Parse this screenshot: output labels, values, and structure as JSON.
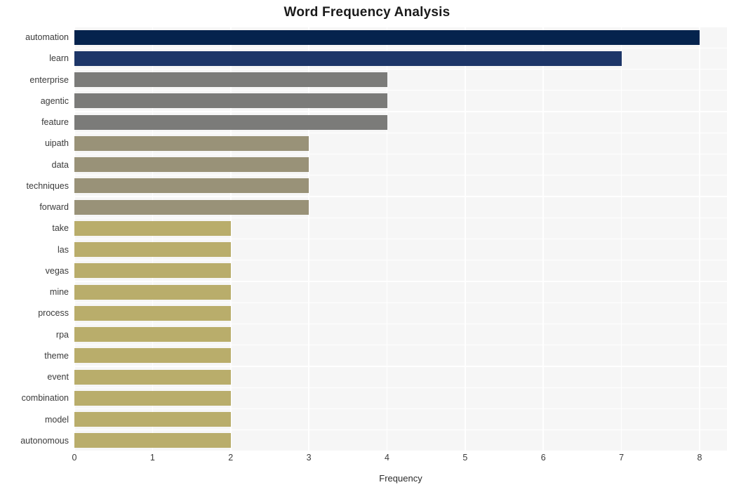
{
  "chart_data": {
    "type": "bar",
    "orientation": "horizontal",
    "title": "Word Frequency Analysis",
    "xlabel": "Frequency",
    "ylabel": "",
    "xlim": [
      0,
      8.35
    ],
    "xticks": [
      0,
      1,
      2,
      3,
      4,
      5,
      6,
      7,
      8
    ],
    "xtick_labels": [
      "0",
      "1",
      "2",
      "3",
      "4",
      "5",
      "6",
      "7",
      "8"
    ],
    "grid": true,
    "legend": false,
    "categories": [
      "automation",
      "learn",
      "enterprise",
      "agentic",
      "feature",
      "uipath",
      "data",
      "techniques",
      "forward",
      "take",
      "las",
      "vegas",
      "mine",
      "process",
      "rpa",
      "theme",
      "event",
      "combination",
      "model",
      "autonomous"
    ],
    "values": [
      8,
      7,
      4,
      4,
      4,
      3,
      3,
      3,
      3,
      2,
      2,
      2,
      2,
      2,
      2,
      2,
      2,
      2,
      2,
      2
    ],
    "bar_colors": [
      "#05234d",
      "#1d3668",
      "#7b7b79",
      "#7b7b79",
      "#7b7b79",
      "#999278",
      "#999278",
      "#999278",
      "#999278",
      "#b9ad6b",
      "#b9ad6b",
      "#b9ad6b",
      "#b9ad6b",
      "#b9ad6b",
      "#b9ad6b",
      "#b9ad6b",
      "#b9ad6b",
      "#b9ad6b",
      "#b9ad6b",
      "#b9ad6b"
    ],
    "plot_background": "#f6f6f6",
    "grid_color": "#ffffff",
    "figure_background": "#ffffff"
  }
}
